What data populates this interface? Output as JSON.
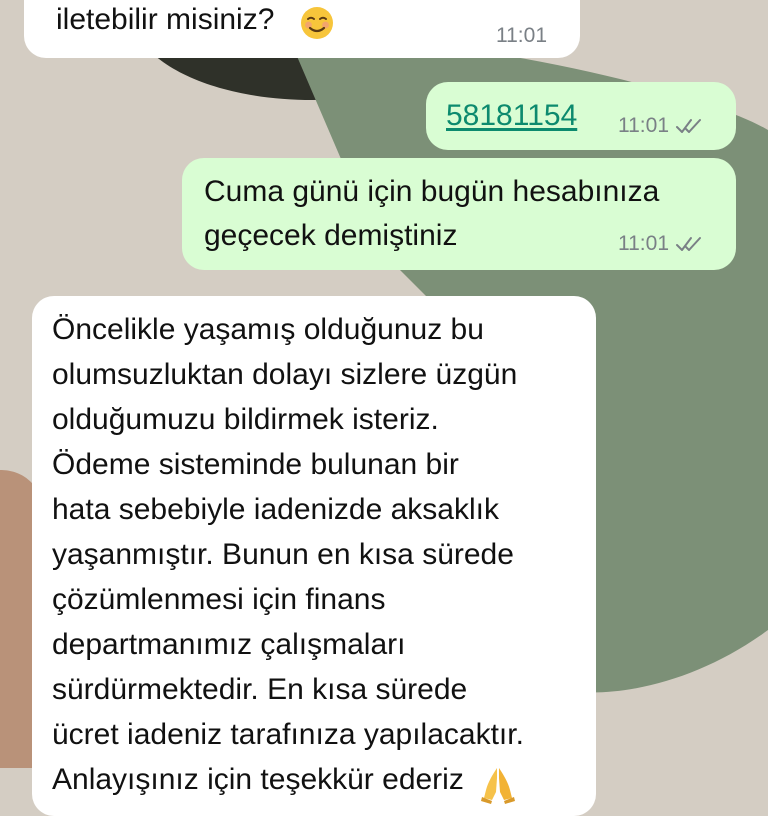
{
  "colors": {
    "wallpaper_base": "#d4cdc3",
    "wallpaper_green": "#7c9077",
    "wallpaper_dark": "#2f3129",
    "wallpaper_brown": "#b99279",
    "incoming_bubble": "#ffffff",
    "outgoing_bubble": "#d9fdd3",
    "link": "#0c8a6e",
    "timestamp": "#7a8086"
  },
  "messages": [
    {
      "direction": "incoming",
      "lines": [
        "iletebilir misiniz?"
      ],
      "emoji": "smiling-face-icon",
      "time": "11:01"
    },
    {
      "direction": "outgoing",
      "link_text": "58181154",
      "time": "11:01",
      "status_icon": "double-check-icon"
    },
    {
      "direction": "outgoing",
      "lines": [
        "Cuma günü için bugün hesabınıza",
        "geçecek demiştiniz"
      ],
      "time": "11:01",
      "status_icon": "double-check-icon"
    },
    {
      "direction": "incoming",
      "lines": [
        "Öncelikle yaşamış olduğunuz bu",
        "olumsuzluktan dolayı sizlere üzgün",
        "olduğumuzu bildirmek isteriz.",
        "Ödeme sisteminde bulunan bir",
        "hata sebebiyle iadenizde aksaklık",
        "yaşanmıştır. Bunun en kısa sürede",
        "çözümlenmesi için finans",
        "departmanımız çalışmaları",
        "sürdürmektedir. En kısa sürede",
        "ücret iadeniz tarafınıza yapılacaktır.",
        "Anlayışınız için teşekkür ederiz"
      ],
      "emoji": "folded-hands-icon"
    }
  ]
}
